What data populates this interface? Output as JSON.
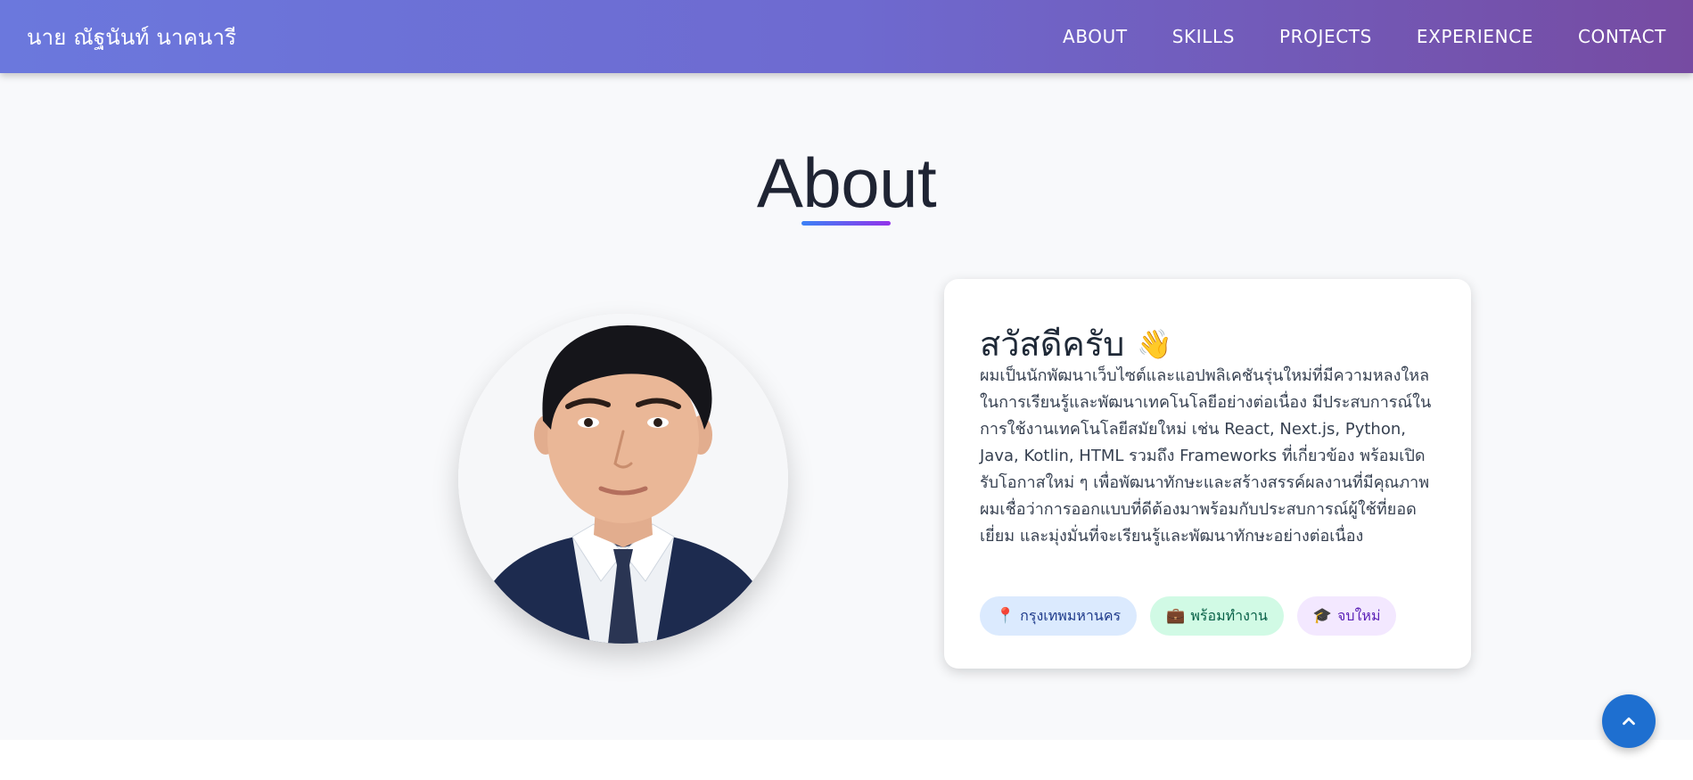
{
  "nav": {
    "brand": "นาย ณัฐนันท์ นาคนารี",
    "links": [
      "ABOUT",
      "SKILLS",
      "PROJECTS",
      "EXPERIENCE",
      "CONTACT"
    ]
  },
  "about": {
    "title": "About",
    "greeting": "สวัสดีครับ",
    "greeting_emoji": "👋",
    "paragraphs": [
      "ผมเป็นนักพัฒนาเว็บไซต์และแอปพลิเคชันรุ่นใหม่ที่มีความหลงใหลในการเรียนรู้และพัฒนาเทคโนโลยีอย่างต่อเนื่อง มีประสบการณ์ในการใช้งานเทคโนโลยีสมัยใหม่ เช่น React, Next.js, Python, Java, Kotlin, HTML รวมถึง Frameworks ที่เกี่ยวข้อง พร้อมเปิดรับโอกาสใหม่ ๆ เพื่อพัฒนาทักษะและสร้างสรรค์ผลงานที่มีคุณภาพ",
      "ผมเชื่อว่าการออกแบบที่ดีต้องมาพร้อมกับประสบการณ์ผู้ใช้ที่ยอดเยี่ยม และมุ่งมั่นที่จะเรียนรู้และพัฒนาทักษะอย่างต่อเนื่อง"
    ],
    "tags": [
      {
        "icon": "📍",
        "label": "กรุงเทพมหานคร"
      },
      {
        "icon": "💼",
        "label": "พร้อมทำงาน"
      },
      {
        "icon": "🎓",
        "label": "จบใหม่"
      }
    ]
  },
  "colors": {
    "nav_gradient_start": "#6b78dd",
    "nav_gradient_end": "#764ba2",
    "accent_blue": "#3b82f6",
    "accent_purple": "#9333ea",
    "scroll_button": "#1e6fd0"
  },
  "icons": {
    "greeting": "waving-hand-icon",
    "scroll_top": "chevron-up-icon"
  }
}
